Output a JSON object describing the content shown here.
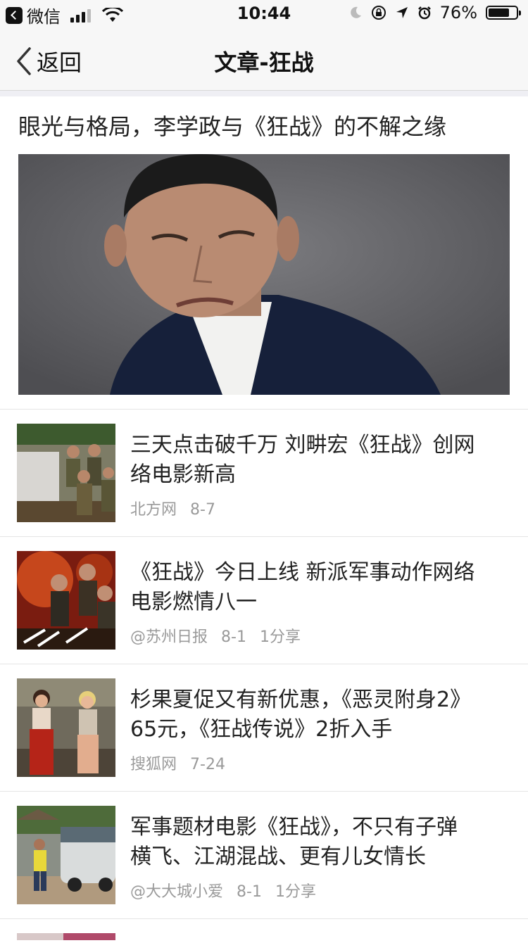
{
  "status_bar": {
    "back_app": "微信",
    "time": "10:44",
    "battery_percent": "76%",
    "battery_level": 0.76
  },
  "nav": {
    "back_label": "返回",
    "title": "文章-狂战"
  },
  "featured": {
    "title": "眼光与格局，李学政与《狂战》的不解之缘"
  },
  "articles": [
    {
      "title_line1": "三天点击破千万 刘畊宏《狂战》创网",
      "title_line2": "络电影新高",
      "source": "北方网",
      "date": "8-7",
      "shares": ""
    },
    {
      "title_line1": "《狂战》今日上线 新派军事动作网络",
      "title_line2": "电影燃情八一",
      "source": "@苏州日报",
      "date": "8-1",
      "shares": "1分享"
    },
    {
      "title_line1": "杉果夏促又有新优惠，《恶灵附身2》",
      "title_line2": "65元，《狂战传说》2折入手",
      "source": "搜狐网",
      "date": "7-24",
      "shares": ""
    },
    {
      "title_line1": "军事题材电影《狂战》，不只有子弹",
      "title_line2": "横飞、江湖混战、更有儿女情长",
      "source": "@大大城小爱",
      "date": "8-1",
      "shares": "1分享"
    }
  ]
}
